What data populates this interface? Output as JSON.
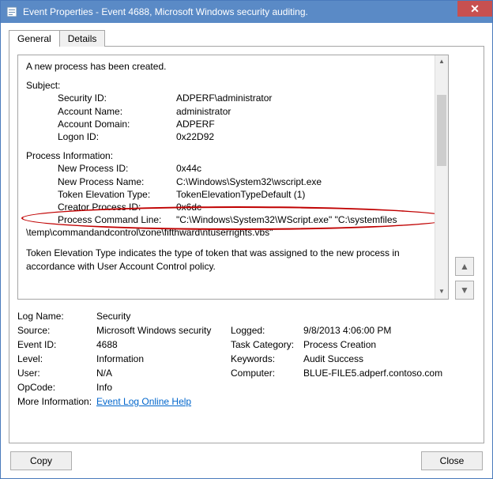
{
  "window": {
    "title": "Event Properties - Event 4688, Microsoft Windows security auditing.",
    "close_glyph": "✕"
  },
  "tabs": {
    "general": "General",
    "details": "Details"
  },
  "event_text": {
    "heading": "A new process has been created.",
    "subject_label": "Subject:",
    "security_id_label": "Security ID:",
    "security_id": "ADPERF\\administrator",
    "account_name_label": "Account Name:",
    "account_name": "administrator",
    "account_domain_label": "Account Domain:",
    "account_domain": "ADPERF",
    "logon_id_label": "Logon ID:",
    "logon_id": "0x22D92",
    "proc_info_label": "Process Information:",
    "new_pid_label": "New Process ID:",
    "new_pid": "0x44c",
    "new_pname_label": "New Process Name:",
    "new_pname": "C:\\Windows\\System32\\wscript.exe",
    "tet_label": "Token Elevation Type:",
    "tet": "TokenElevationTypeDefault (1)",
    "creator_pid_label": "Creator Process ID:",
    "creator_pid": "0x6dc",
    "cmdline_label": "Process Command Line:",
    "cmdline_part1": "\"C:\\Windows\\System32\\WScript.exe\" \"C:\\systemfiles",
    "cmdline_part2": "\\temp\\commandandcontrol\\zone\\fifthward\\ntuserrights.vbs\"",
    "footer1": "Token Elevation Type indicates the type of token that was assigned to the new process in",
    "footer2": "accordance with User Account Control policy."
  },
  "meta": {
    "log_name_label": "Log Name:",
    "log_name": "Security",
    "source_label": "Source:",
    "source": "Microsoft Windows security",
    "logged_label": "Logged:",
    "logged": "9/8/2013 4:06:00 PM",
    "event_id_label": "Event ID:",
    "event_id": "4688",
    "task_cat_label": "Task Category:",
    "task_cat": "Process Creation",
    "level_label": "Level:",
    "level": "Information",
    "keywords_label": "Keywords:",
    "keywords": "Audit Success",
    "user_label": "User:",
    "user": "N/A",
    "computer_label": "Computer:",
    "computer": "BLUE-FILE5.adperf.contoso.com",
    "opcode_label": "OpCode:",
    "opcode": "Info",
    "more_info_label": "More Information:",
    "more_info_link": "Event Log Online Help"
  },
  "buttons": {
    "copy": "Copy",
    "close": "Close",
    "up_glyph": "▲",
    "down_glyph": "▼"
  },
  "scrollbar": {
    "up": "▲",
    "down": "▼"
  }
}
